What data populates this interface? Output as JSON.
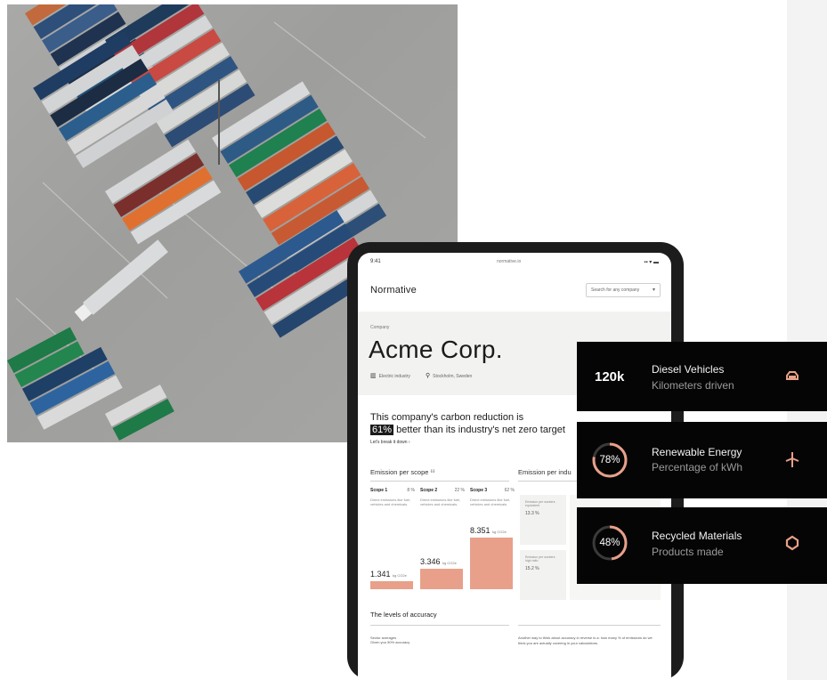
{
  "tablet": {
    "status_time": "9:41",
    "status_center": "normative.io",
    "status_right": "▪▪ ▾ ▬",
    "brand": "Normative",
    "search_placeholder": "Search for any company",
    "company_kicker": "Company",
    "company_name": "Acme Corp.",
    "industry": "Electric industry",
    "location": "Stockholm, Sweden",
    "reduction_line1": "This company's carbon reduction is",
    "reduction_highlight": "61%",
    "reduction_line2": "better than its industry's net zero target",
    "breakdown_link": "Let's break it down ›",
    "emission_scope_title": "Emission per scope ⁽ⁱ⁾",
    "emission_industry_title": "Emission per indu",
    "scopes": [
      {
        "name": "Scope 1",
        "pct": "8 %",
        "desc": "Direct emissions like fuel, vehicles and chemicals.",
        "value": "1.341",
        "unit": "kg CO2e",
        "share": 0.16
      },
      {
        "name": "Scope 2",
        "pct": "22 %",
        "desc": "Direct emissions like fuel, vehicles and chemicals.",
        "value": "3.346",
        "unit": "kg CO2e",
        "share": 0.4
      },
      {
        "name": "Scope 3",
        "pct": "62 %",
        "desc": "Direct emissions like fuel, vehicles and chemicals.",
        "value": "8.351",
        "unit": "kg CO2e",
        "share": 1.0
      }
    ],
    "intensity_cards": [
      {
        "label": "Emission per workers equivalent",
        "value": "13.3 %"
      },
      {
        "label": "Emission per workers high ratio",
        "value": "15.2 %"
      }
    ],
    "accuracy_title": "The levels of accuracy",
    "accuracy_left_label": "Sector averages",
    "accuracy_left_value": "Given you 50% accuracy",
    "accuracy_right_text": "Another way to think about accuracy in reverse is a: how many % of emissions do we think you are actually covering in your calculations."
  },
  "cards": [
    {
      "big": "120k",
      "title": "Diesel Vehicles",
      "subtitle": "Kilometers driven",
      "icon": "car-icon"
    },
    {
      "ring_label": "78%",
      "ring_value": 0.78,
      "title": "Renewable Energy",
      "subtitle": "Percentage of kWh",
      "icon": "wind-turbine-icon"
    },
    {
      "ring_label": "48%",
      "ring_value": 0.48,
      "title": "Recycled Materials",
      "subtitle": "Products made",
      "icon": "recycle-icon"
    }
  ],
  "colors": {
    "accent": "#e8a08a",
    "card_bg": "#050505",
    "ring_track": "#3a3a3a"
  }
}
